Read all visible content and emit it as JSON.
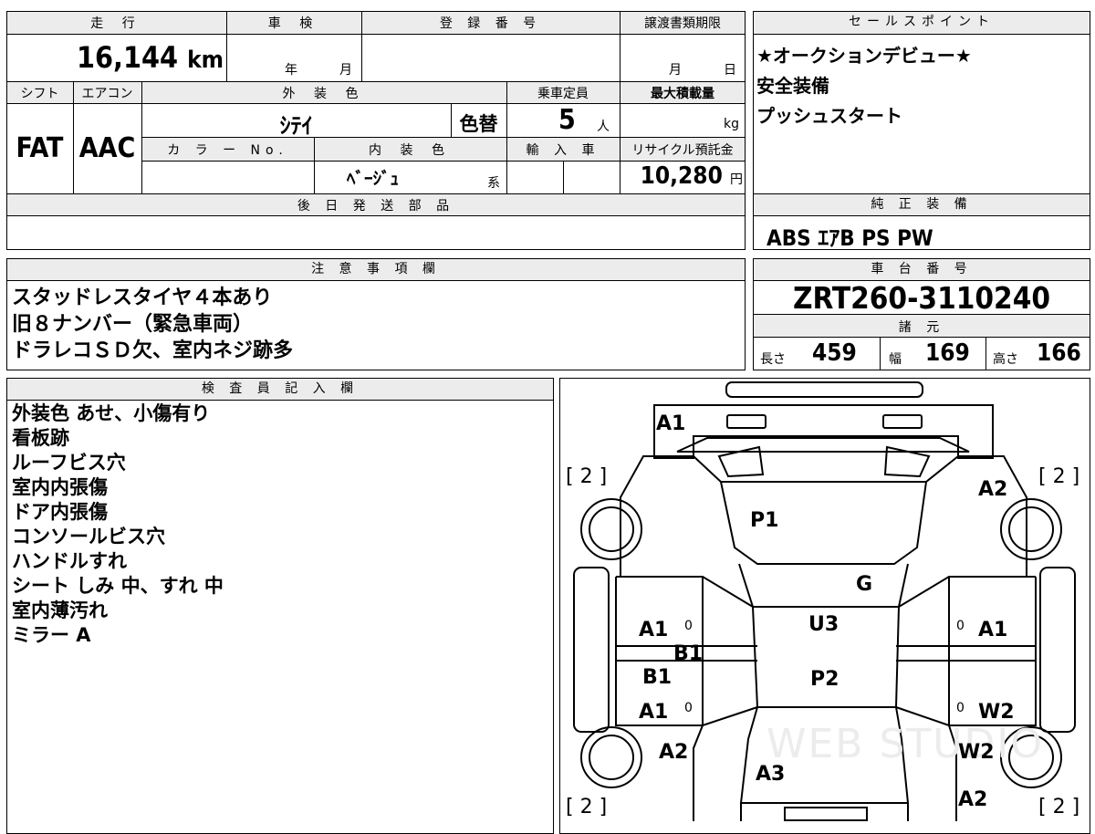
{
  "top": {
    "mileage_label": "走 行",
    "mileage_value": "16,144",
    "mileage_unit": "km",
    "shaken_label": "車 検",
    "shaken_year": "年",
    "shaken_month": "月",
    "reg_label": "登 録 番 号",
    "transfer_label": "譲渡書類期限",
    "transfer_month": "月",
    "transfer_day": "日",
    "shift_label": "シフト",
    "ac_label": "エアコン",
    "ext_color_label": "外 装 色",
    "capacity_label": "乗車定員",
    "max_load_label": "最大積載量",
    "ext_color_value": "ｼﾃｲ",
    "color_change": "色替",
    "capacity_value": "5",
    "capacity_unit": "人",
    "load_unit": "kg",
    "shift_value": "FAT",
    "ac_value": "AAC",
    "color_no_label": "カ ラ ー No.",
    "int_color_label": "内 装 色",
    "import_label": "輸 入 車",
    "recycle_label": "リサイクル預託金",
    "int_color_value": "ﾍﾞｰｼﾞｭ",
    "int_color_suffix": "系",
    "recycle_value": "10,280",
    "recycle_unit": "円",
    "later_parts_label": "後 日 発 送 部 品"
  },
  "sales_point": {
    "label": "セールスポイント",
    "lines": [
      "★オークションデビュー★",
      "安全装備",
      "プッシュスタート"
    ]
  },
  "genuine": {
    "label": "純 正 装 備",
    "value": "ABS ｴｱB PS PW"
  },
  "notes": {
    "label": "注 意 事 項 欄",
    "lines": [
      "スタッドレスタイヤ４本あり",
      "旧８ナンバー（緊急車両）",
      "ドラレコＳＤ欠、室内ネジ跡多"
    ]
  },
  "chassis": {
    "label": "車 台 番 号",
    "value": "ZRT260-3110240"
  },
  "specs": {
    "label": "諸 元",
    "length_label": "長さ",
    "length": "459",
    "width_label": "幅",
    "width": "169",
    "height_label": "高さ",
    "height": "166"
  },
  "inspector": {
    "label": "検 査 員 記 入 欄",
    "lines": [
      "外装色 あせ、小傷有り",
      "看板跡",
      "ルーフビス穴",
      "室内内張傷",
      "ドア内張傷",
      "コンソールビス穴",
      "ハンドルすれ",
      "シート しみ 中、すれ 中",
      "室内薄汚れ",
      "ミラー A"
    ]
  },
  "diagram": {
    "tire_marks": [
      "[ 2 ]",
      "[ 2 ]",
      "[ 2 ]",
      "[ 2 ]"
    ],
    "labels": {
      "a1_front": "A1",
      "a2_front_right": "A2",
      "p1": "P1",
      "g": "G",
      "a1_left_top": "A1",
      "b1_left_a": "B1",
      "b1_left_b": "B1",
      "a1_left_bottom": "A1",
      "u3": "U3",
      "p2": "P2",
      "a1_right_top": "A1",
      "w2_right_a": "W2",
      "w2_right_b": "W2",
      "a2_left_rear": "A2",
      "a3": "A3",
      "a2_right_rear": "A2",
      "zero1": "0",
      "zero2": "0",
      "zero3": "0",
      "zero4": "0"
    },
    "watermark": "WEB STUDIO"
  }
}
